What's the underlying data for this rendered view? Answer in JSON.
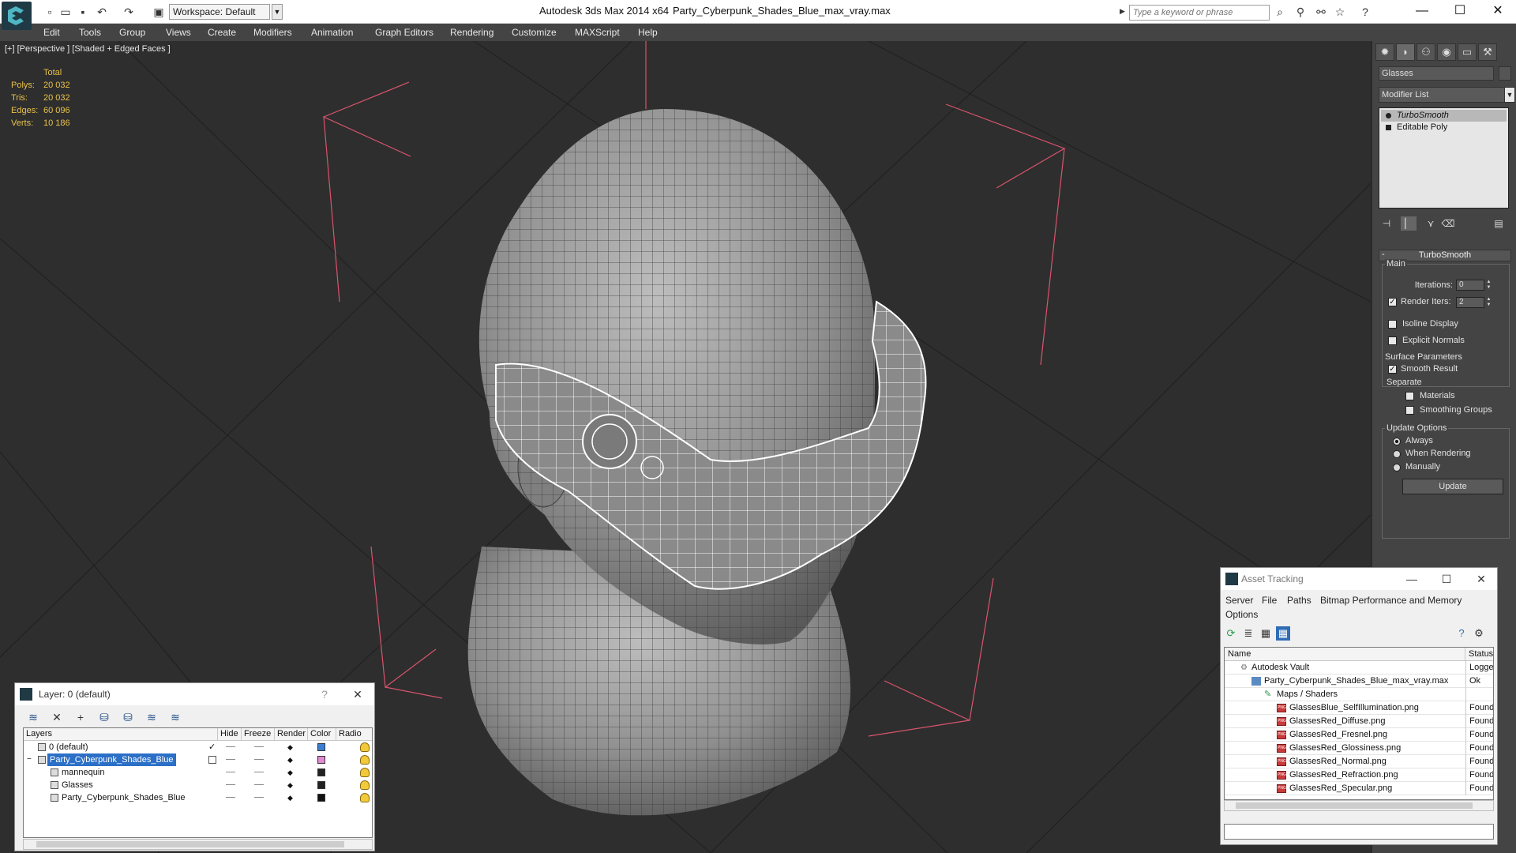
{
  "titlebar": {
    "workspace": "Workspace: Default",
    "app_title": "Autodesk 3ds Max  2014 x64",
    "doc_title": "Party_Cyberpunk_Shades_Blue_max_vray.max",
    "search_placeholder": "Type a keyword or phrase",
    "icons": [
      "new-file-icon",
      "open-file-icon",
      "save-icon",
      "undo-icon",
      "redo-icon",
      "project-folder-icon",
      "binoculars-icon",
      "subscription-icon",
      "communication-icon",
      "favorites-star-icon",
      "help-icon"
    ]
  },
  "menu": [
    "Edit",
    "Tools",
    "Group",
    "Views",
    "Create",
    "Modifiers",
    "Animation",
    "Graph Editors",
    "Rendering",
    "Customize",
    "MAXScript",
    "Help"
  ],
  "viewport": {
    "label": "[+] [Perspective ] [Shaded + Edged Faces ]",
    "stats": {
      "header": "Total",
      "rows": [
        {
          "key": "Polys:",
          "value": "20 032"
        },
        {
          "key": "Tris:",
          "value": "20 032"
        },
        {
          "key": "Edges:",
          "value": "60 096"
        },
        {
          "key": "Verts:",
          "value": "10 186"
        }
      ]
    }
  },
  "command_panel": {
    "object_name": "Glasses",
    "modifier_list": "Modifier List",
    "stack": [
      "TurboSmooth",
      "Editable Poly"
    ],
    "rollout_title": "TurboSmooth",
    "main_group": "Main",
    "iterations_label": "Iterations:",
    "iterations_value": "0",
    "render_iters_label": "Render Iters:",
    "render_iters_value": "2",
    "isoline_label": "Isoline Display",
    "explicit_normals_label": "Explicit Normals",
    "surface_group": "Surface Parameters",
    "smooth_result_label": "Smooth Result",
    "separate_label": "Separate",
    "materials_label": "Materials",
    "smoothing_groups_label": "Smoothing Groups",
    "update_group": "Update Options",
    "always_label": "Always",
    "when_rendering_label": "When Rendering",
    "manually_label": "Manually",
    "update_button": "Update"
  },
  "layer_dialog": {
    "title": "Layer: 0 (default)",
    "help": "?",
    "columns": [
      "Layers",
      "Hide",
      "Freeze",
      "Render",
      "Color",
      "Radio"
    ],
    "rows": [
      {
        "name": "0 (default)",
        "color": "#3b7fd4"
      },
      {
        "name": "Party_Cyberpunk_Shades_Blue",
        "color": "#e08ad0"
      },
      {
        "name": "mannequin",
        "color": "#222222"
      },
      {
        "name": "Glasses",
        "color": "#222222"
      },
      {
        "name": "Party_Cyberpunk_Shades_Blue",
        "color": "#111111"
      }
    ]
  },
  "asset_dialog": {
    "title": "Asset Tracking",
    "menus": [
      "Server",
      "File",
      "Paths",
      "Bitmap Performance and Memory",
      "Options"
    ],
    "columns": [
      "Name",
      "Status"
    ],
    "rows": [
      {
        "name": "Autodesk Vault",
        "status": "Logged"
      },
      {
        "name": "Party_Cyberpunk_Shades_Blue_max_vray.max",
        "status": "Ok"
      },
      {
        "name": "Maps / Shaders",
        "status": ""
      },
      {
        "name": "GlassesBlue_SelfIllumination.png",
        "status": "Found"
      },
      {
        "name": "GlassesRed_Diffuse.png",
        "status": "Found"
      },
      {
        "name": "GlassesRed_Fresnel.png",
        "status": "Found"
      },
      {
        "name": "GlassesRed_Glossiness.png",
        "status": "Found"
      },
      {
        "name": "GlassesRed_Normal.png",
        "status": "Found"
      },
      {
        "name": "GlassesRed_Refraction.png",
        "status": "Found"
      },
      {
        "name": "GlassesRed_Specular.png",
        "status": "Found"
      }
    ]
  },
  "colors": {
    "stats_text": "#e8c24a",
    "selection_blue": "#2b6fc7",
    "gizmo_pink": "#d9546e",
    "viewport_bg": "#2e2e2e"
  }
}
